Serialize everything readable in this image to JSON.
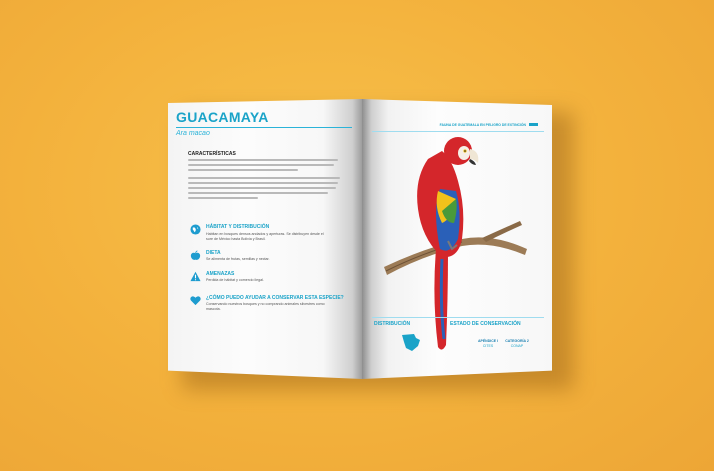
{
  "left_page": {
    "title": "GUACAMAYA",
    "scientific_name": "Ara macao",
    "characteristics": {
      "title": "CARACTERÍSTICAS"
    },
    "sections": [
      {
        "icon": "globe-icon",
        "title": "HÁBITAT Y DISTRIBUCIÓN",
        "text": "Habitan en bosques densos andados y aperturas. Se distribuyen desde el sure de México hasta Bolivia y Brasil."
      },
      {
        "icon": "apple-icon",
        "title": "DIETA",
        "text": "Se alimenta de frutas, semillas y nectar."
      },
      {
        "icon": "warning-icon",
        "title": "AMENAZAS",
        "text": "Perdida de hábitat y comercio ilegal."
      },
      {
        "icon": "heart-icon",
        "title": "¿CÓMO PUEDO AYUDAR A CONSERVAR ESTA ESPECIE?",
        "text": "Conservando nuestros bosques y no comprando animales silvestres como mascota."
      }
    ]
  },
  "right_page": {
    "header": "FAUNA DE GUATEMALA EN PELIGRO DE EXTINCIÓN",
    "distribution_label": "DISTRIBUCIÓN",
    "conservation_label": "ESTADO DE CONSERVACIÓN",
    "status": [
      {
        "label": "APÉNDICE I",
        "sub": "CITES"
      },
      {
        "label": "CATEGORÍA 2",
        "sub": "CONAP"
      }
    ]
  },
  "colors": {
    "background": "#f3b13c",
    "accent": "#1aa3c8",
    "parrot_red": "#d4262b",
    "parrot_blue": "#2a60b8",
    "parrot_yellow": "#f2c21b"
  }
}
